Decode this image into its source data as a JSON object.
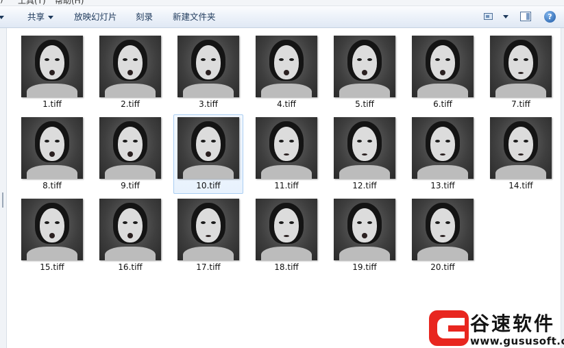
{
  "menu": {
    "items": [
      "工具(T)",
      "帮助(H)"
    ]
  },
  "toolbar": {
    "share_label": "共享",
    "slideshow_label": "放映幻灯片",
    "burn_label": "刻录",
    "new_folder_label": "新建文件夹",
    "view_icon": "change-view-icon",
    "preview_pane_icon": "preview-pane-icon",
    "help_icon": "help-icon",
    "help_glyph": "?"
  },
  "files": [
    {
      "name": "1.tiff"
    },
    {
      "name": "2.tiff"
    },
    {
      "name": "3.tiff"
    },
    {
      "name": "4.tiff"
    },
    {
      "name": "5.tiff"
    },
    {
      "name": "6.tiff"
    },
    {
      "name": "7.tiff"
    },
    {
      "name": "8.tiff"
    },
    {
      "name": "9.tiff"
    },
    {
      "name": "10.tiff",
      "selected": true
    },
    {
      "name": "11.tiff"
    },
    {
      "name": "12.tiff"
    },
    {
      "name": "13.tiff"
    },
    {
      "name": "14.tiff"
    },
    {
      "name": "15.tiff"
    },
    {
      "name": "16.tiff"
    },
    {
      "name": "17.tiff"
    },
    {
      "name": "18.tiff"
    },
    {
      "name": "19.tiff"
    },
    {
      "name": "20.tiff"
    }
  ],
  "watermark": {
    "title": "谷速软件",
    "url": "www.gususoft.com",
    "brand_color": "#e8261f"
  },
  "colors": {
    "selection_border": "#a9cdf2",
    "toolbar_text": "#1e395b"
  }
}
